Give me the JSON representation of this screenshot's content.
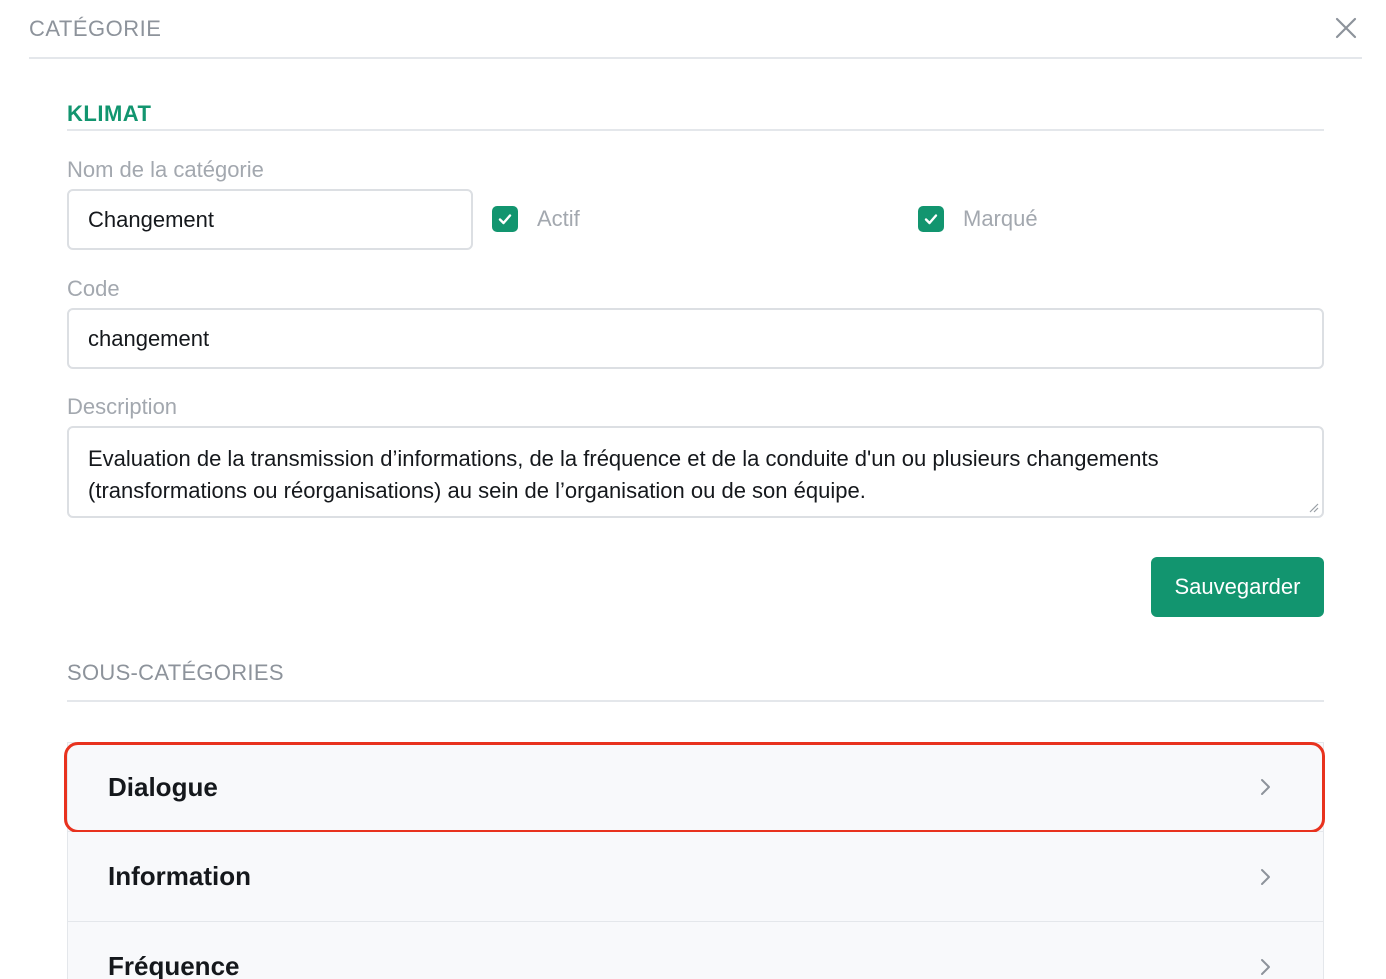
{
  "modal": {
    "title": "CATÉGORIE"
  },
  "category": {
    "group_title": "KLIMAT",
    "name_label": "Nom de la catégorie",
    "name_value": "Changement",
    "active_label": "Actif",
    "active_checked": true,
    "marked_label": "Marqué",
    "marked_checked": true,
    "code_label": "Code",
    "code_value": "changement",
    "description_label": "Description",
    "description_value": "Evaluation de la transmission d’informations, de la fréquence et de la conduite d'un ou plusieurs changements (transformations ou réorganisations) au sein de l’organisation ou de son équipe.",
    "save_label": "Sauvegarder"
  },
  "subcategories": {
    "title": "SOUS-CATÉGORIES",
    "items": [
      {
        "label": "Dialogue",
        "highlighted": true
      },
      {
        "label": "Information",
        "highlighted": false
      },
      {
        "label": "Fréquence",
        "highlighted": false
      }
    ]
  },
  "colors": {
    "accent": "#12956f",
    "highlight": "#e8321e"
  }
}
